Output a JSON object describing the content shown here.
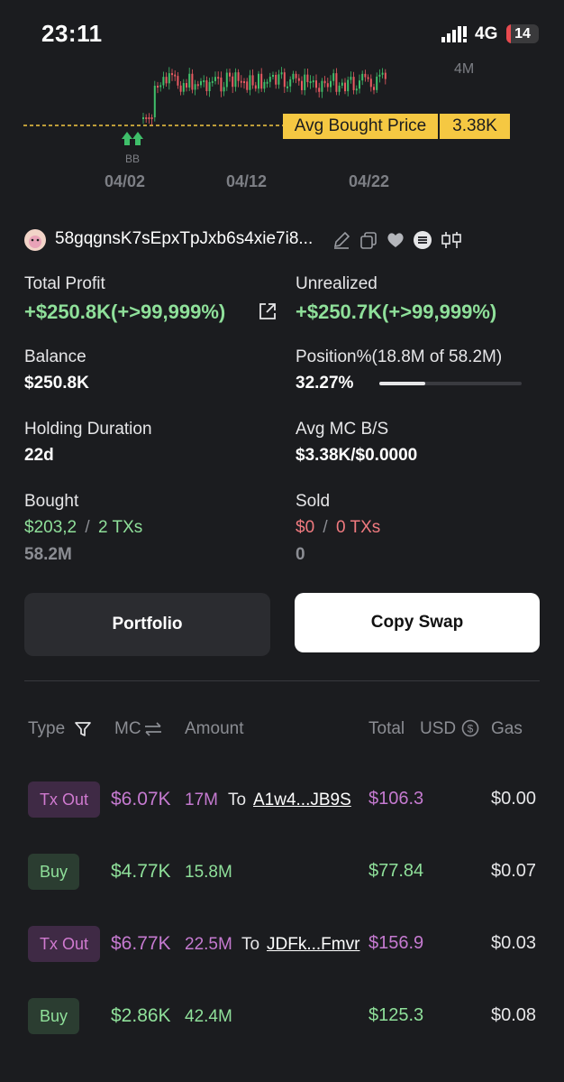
{
  "status_bar": {
    "time": "23:11",
    "network": "4G",
    "battery": "14",
    "battery_level": 0.14
  },
  "chart": {
    "y_label": "4M",
    "avg_bought_label": "Avg Bought Price",
    "avg_bought_value": "3.38K",
    "marker_label": "BB",
    "x_ticks": [
      "04/02",
      "04/12",
      "04/22"
    ]
  },
  "wallet": {
    "address": "58gqgnsK7sEpxTpJxb6s4xie7i8..."
  },
  "stats": {
    "total_profit_label": "Total Profit",
    "total_profit_value": "+$250.8K(+>99,999%)",
    "unrealized_label": "Unrealized",
    "unrealized_value": "+$250.7K(+>99,999%)",
    "balance_label": "Balance",
    "balance_value": "$250.8K",
    "position_label": "Position%(18.8M of 58.2M)",
    "position_value": "32.27%",
    "position_fraction": 0.3227,
    "holding_label": "Holding Duration",
    "holding_value": "22d",
    "avg_mc_label": "Avg MC B/S",
    "avg_mc_value": "$3.38K/$0.0000",
    "bought_label": "Bought",
    "bought_usd": "$203,2",
    "bought_sep": "/",
    "bought_txs": "2 TXs",
    "bought_amount": "58.2M",
    "sold_label": "Sold",
    "sold_usd": "$0",
    "sold_sep": "/",
    "sold_txs": "0 TXs",
    "sold_amount": "0"
  },
  "buttons": {
    "portfolio": "Portfolio",
    "copy_swap": "Copy Swap"
  },
  "table": {
    "headers": {
      "type": "Type",
      "mc": "MC",
      "amount": "Amount",
      "total": "Total",
      "usd": "USD",
      "gas": "Gas"
    },
    "rows": [
      {
        "type": "Tx Out",
        "mc": "$6.07K",
        "amount": "17M",
        "to": "To",
        "address": "A1w4...JB9S",
        "total": "$106.3",
        "gas": "$0.00"
      },
      {
        "type": "Buy",
        "mc": "$4.77K",
        "amount": "15.8M",
        "to": "",
        "address": "",
        "total": "$77.84",
        "gas": "$0.07"
      },
      {
        "type": "Tx Out",
        "mc": "$6.77K",
        "amount": "22.5M",
        "to": "To",
        "address": "JDFk...Fmvr",
        "total": "$156.9",
        "gas": "$0.03"
      },
      {
        "type": "Buy",
        "mc": "$2.86K",
        "amount": "42.4M",
        "to": "",
        "address": "",
        "total": "$125.3",
        "gas": "$0.08"
      }
    ]
  },
  "colors": {
    "positive": "#8fe09a",
    "negative": "#f07a7f",
    "accent_yellow": "#f5c842",
    "tx_out": "#c57ad0"
  }
}
